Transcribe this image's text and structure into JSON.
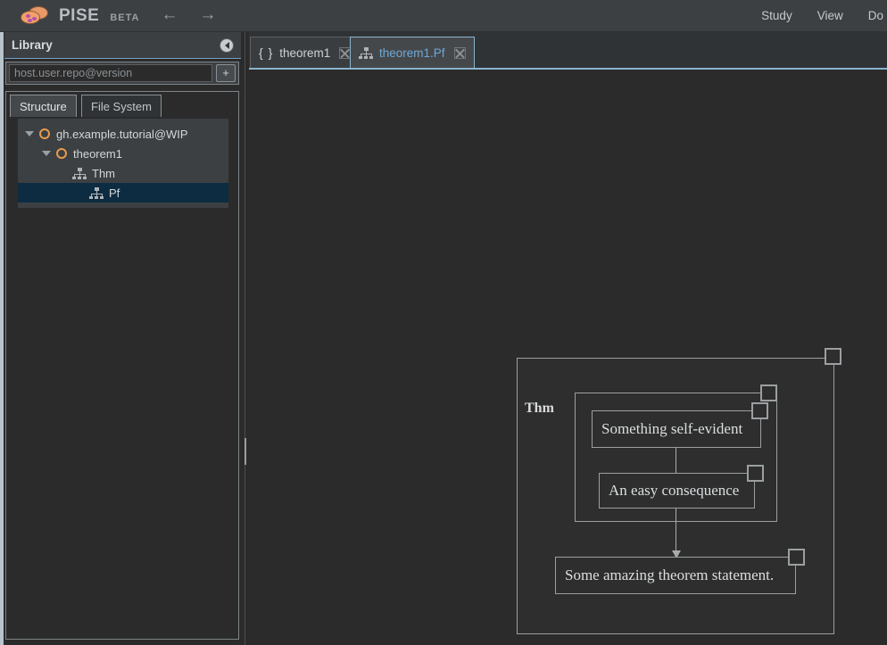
{
  "app": {
    "brand_name": "PISE",
    "brand_tag": "BETA",
    "logo_icon": "pizza-logo-icon",
    "nav_back_icon": "←",
    "nav_forward_icon": "→"
  },
  "menubar": {
    "items": [
      {
        "label": "Study"
      },
      {
        "label": "View"
      },
      {
        "label": "Do"
      }
    ]
  },
  "sidebar": {
    "library": {
      "title": "Library",
      "collapse_icon": "collapse-panel-icon",
      "repo_input_value": "",
      "repo_input_placeholder": "host.user.repo@version",
      "add_button_label": "+"
    },
    "subtabs": [
      {
        "label": "Structure",
        "active": true
      },
      {
        "label": "File System",
        "active": false
      }
    ],
    "tree": [
      {
        "label": "gh.example.tutorial@WIP",
        "icon": "module-ring-icon",
        "caret": "▼",
        "depth": 0,
        "selected": false
      },
      {
        "label": "theorem1",
        "icon": "module-ring-icon",
        "caret": "▼",
        "depth": 1,
        "selected": false
      },
      {
        "label": "Thm",
        "icon": "hierarchy-icon",
        "caret": "",
        "depth": 2,
        "selected": false
      },
      {
        "label": "Pf",
        "icon": "hierarchy-icon",
        "caret": "",
        "depth": 3,
        "selected": true
      }
    ]
  },
  "editor": {
    "tabs": [
      {
        "label": "theorem1",
        "icon": "braces-icon",
        "active": false,
        "close_icon": "close-icon"
      },
      {
        "label": "theorem1.Pf",
        "icon": "hierarchy-icon",
        "active": true,
        "close_icon": "close-icon"
      }
    ]
  },
  "diagram": {
    "outer_label": "Thm",
    "nodes": [
      {
        "text": "Something self-evident"
      },
      {
        "text": "An easy consequence"
      },
      {
        "text": "Some amazing theorem statement."
      }
    ]
  },
  "colors": {
    "accent_blue": "#6fa8d6",
    "topbar": "#3c4043",
    "panel": "#2b2b2b",
    "selection": "#0e2c41",
    "ring_orange": "#e89b4c",
    "edge_light": "#b8c4cc"
  }
}
